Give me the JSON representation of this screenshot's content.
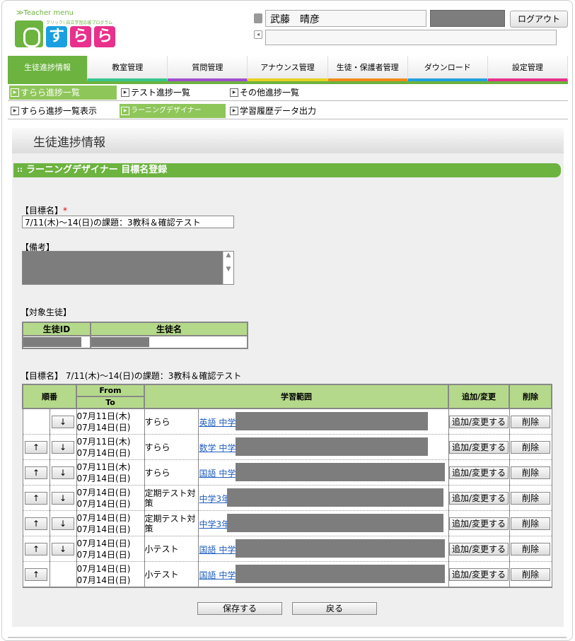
{
  "header": {
    "teacher_menu": "≫Teacher menu",
    "logo_tag": "クリック! 自立学習応援プログラム",
    "logo_chars": [
      "す",
      "ら",
      "ら"
    ],
    "user_name": "武藤　晴彦",
    "logout": "ログアウト"
  },
  "main_tabs": [
    {
      "label": "生徒進捗情報",
      "color": "#6cb33f",
      "active": true
    },
    {
      "label": "教室管理",
      "color": "#35c48f"
    },
    {
      "label": "質問管理",
      "color": "#a14ed0"
    },
    {
      "label": "アナウンス管理",
      "color": "#e8d020"
    },
    {
      "label": "生徒・保護者管理",
      "color": "#f08a1c"
    },
    {
      "label": "ダウンロード",
      "color": "#20a0e0"
    },
    {
      "label": "設定管理",
      "color": "#e8308c"
    }
  ],
  "sub_nav_1": [
    "すらら進捗一覧",
    "テスト進捗一覧",
    "その他進捗一覧"
  ],
  "sub_nav_2": [
    "すらら進捗一覧表示",
    "ラーニングデザイナー",
    "学習履歴データ出力"
  ],
  "page_title": "生徒進捗情報",
  "section_title": "ラーニングデザイナー 目標名登録",
  "form": {
    "goal_label": "【目標名】",
    "goal_required": "*",
    "goal_value": "7/11(木)〜14(日)の課題：3教科＆確認テスト",
    "note_label": "【備考】",
    "target_label": "【対象生徒】",
    "student_cols": [
      "生徒ID",
      "生徒名"
    ],
    "goal_summary_label": "【目標名】",
    "goal_summary_value": "7/11(木)〜14(日)の課題：3教科＆確認テスト"
  },
  "table": {
    "headers": {
      "order": "順番",
      "from": "From",
      "to": "To",
      "range": "学習範囲",
      "edit": "追加/変更",
      "delete": "削除"
    },
    "rows": [
      {
        "up": false,
        "down": true,
        "from": "07月11日(木)",
        "to": "07月14日(日)",
        "type": "すらら",
        "link": "英語 中学",
        "bar": 272
      },
      {
        "up": true,
        "down": true,
        "from": "07月11日(木)",
        "to": "07月14日(日)",
        "type": "すらら",
        "link": "数学 中学",
        "bar": 272
      },
      {
        "up": true,
        "down": true,
        "from": "07月11日(木)",
        "to": "07月14日(日)",
        "type": "すらら",
        "link": "国語 中学",
        "bar": 296
      },
      {
        "up": true,
        "down": true,
        "from": "07月14日(日)",
        "to": "07月14日(日)",
        "type": "定期テスト対策",
        "link": "中学3年",
        "bar": 306
      },
      {
        "up": true,
        "down": true,
        "from": "07月14日(日)",
        "to": "07月14日(日)",
        "type": "定期テスト対策",
        "link": "中学3年",
        "bar": 306
      },
      {
        "up": true,
        "down": true,
        "from": "07月14日(日)",
        "to": "07月14日(日)",
        "type": "小テスト",
        "link": "国語 中学",
        "bar": 296
      },
      {
        "up": true,
        "down": false,
        "from": "07月14日(日)",
        "to": "07月14日(日)",
        "type": "小テスト",
        "link": "国語 中学",
        "bar": 296
      }
    ],
    "edit_button": "追加/変更する",
    "delete_button": "削除",
    "up_glyph": "↑",
    "down_glyph": "↓"
  },
  "buttons": {
    "save": "保存する",
    "back": "戻る"
  }
}
